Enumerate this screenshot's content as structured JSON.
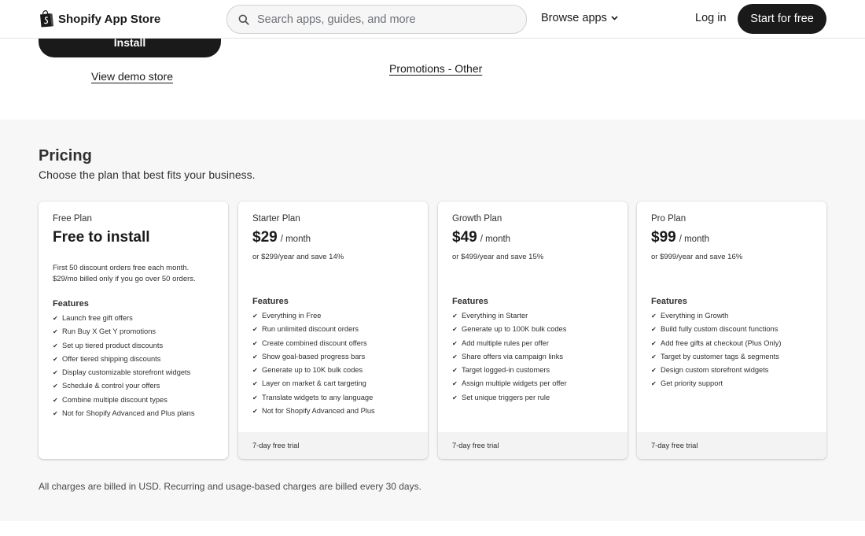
{
  "header": {
    "brand": "Shopify App Store",
    "search_placeholder": "Search apps, guides, and more",
    "browse_label": "Browse apps",
    "login_label": "Log in",
    "start_label": "Start for free"
  },
  "hero": {
    "install_label": "Install",
    "demo_label": "View demo store",
    "category_label": "Promotions - Other"
  },
  "pricing": {
    "title": "Pricing",
    "subtitle": "Choose the plan that best fits your business.",
    "features_label": "Features",
    "plans": [
      {
        "name": "Free Plan",
        "headline": "Free to install",
        "description": "First 50 discount orders free each month. $29/mo billed only if you go over 50 orders.",
        "features": [
          "Launch free gift offers",
          "Run Buy X Get Y promotions",
          "Set up tiered product discounts",
          "Offer tiered shipping discounts",
          "Display customizable storefront widgets",
          "Schedule & control your offers",
          "Combine multiple discount types",
          "Not for Shopify Advanced and Plus plans"
        ]
      },
      {
        "name": "Starter Plan",
        "price": "$29",
        "unit": "/ month",
        "yearly": "or $299/year and save 14%",
        "features": [
          "Everything in Free",
          "Run unlimited discount orders",
          "Create combined discount offers",
          "Show goal-based progress bars",
          "Generate up to 10K bulk codes",
          "Layer on market & cart targeting",
          "Translate widgets to any language",
          "Not for Shopify Advanced and Plus"
        ],
        "trial": "7-day free trial"
      },
      {
        "name": "Growth Plan",
        "price": "$49",
        "unit": "/ month",
        "yearly": "or $499/year and save 15%",
        "features": [
          "Everything in Starter",
          "Generate up to 100K bulk codes",
          "Add multiple rules per offer",
          "Share offers via campaign links",
          "Target logged-in customers",
          "Assign multiple widgets per offer",
          "Set unique triggers per rule"
        ],
        "trial": "7-day free trial"
      },
      {
        "name": "Pro Plan",
        "price": "$99",
        "unit": "/ month",
        "yearly": "or $999/year and save 16%",
        "features": [
          "Everything in Growth",
          "Build fully custom discount functions",
          "Add free gifts at checkout (Plus Only)",
          "Target by customer tags & segments",
          "Design custom storefront widgets",
          "Get priority support"
        ],
        "trial": "7-day free trial"
      }
    ],
    "footnote": "All charges are billed in USD. Recurring and usage-based charges are billed every 30 days."
  }
}
